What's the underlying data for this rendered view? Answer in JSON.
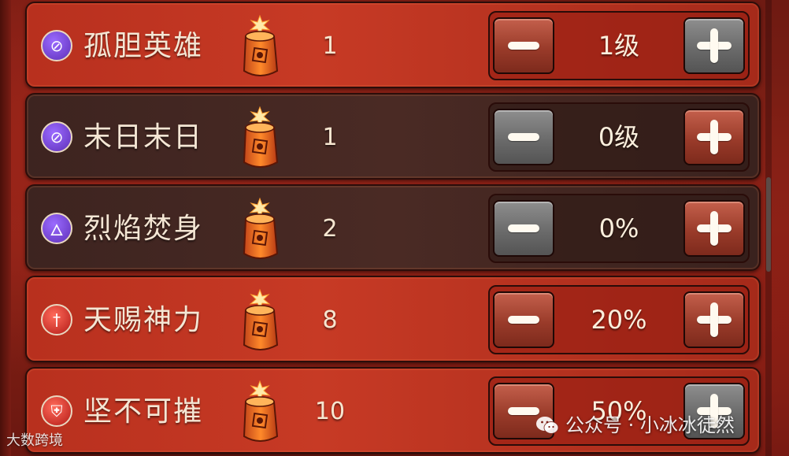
{
  "skills": [
    {
      "name": "孤胆英雄",
      "cost": "1",
      "level": "1级",
      "icon": "crossed-figure-icon",
      "icon_color": "purple",
      "row_style": "red",
      "minus_style": "red",
      "plus_style": "grey"
    },
    {
      "name": "末日末日",
      "cost": "1",
      "level": "0级",
      "icon": "crossed-figure-icon",
      "icon_color": "purple",
      "row_style": "dark",
      "minus_style": "grey",
      "plus_style": "red"
    },
    {
      "name": "烈焰焚身",
      "cost": "2",
      "level": "0%",
      "icon": "flame-icon",
      "icon_color": "purple",
      "row_style": "dark",
      "minus_style": "grey",
      "plus_style": "red"
    },
    {
      "name": "天赐神力",
      "cost": "8",
      "level": "20%",
      "icon": "sword-icon",
      "icon_color": "red",
      "row_style": "red",
      "minus_style": "red",
      "plus_style": "red"
    },
    {
      "name": "坚不可摧",
      "cost": "10",
      "level": "50%",
      "icon": "shield-icon",
      "icon_color": "red",
      "row_style": "red",
      "minus_style": "red",
      "plus_style": "grey"
    }
  ],
  "cost_icon": "firecracker-icon",
  "watermark": {
    "left": "大数跨境",
    "right": "公众号 · 小冰冰徒然"
  },
  "colors": {
    "background": "#8a2317",
    "row_red": "#c73a25",
    "row_dark": "#4a2a24",
    "button_red": "#9a3b2a",
    "button_grey": "#6b6b6b"
  }
}
